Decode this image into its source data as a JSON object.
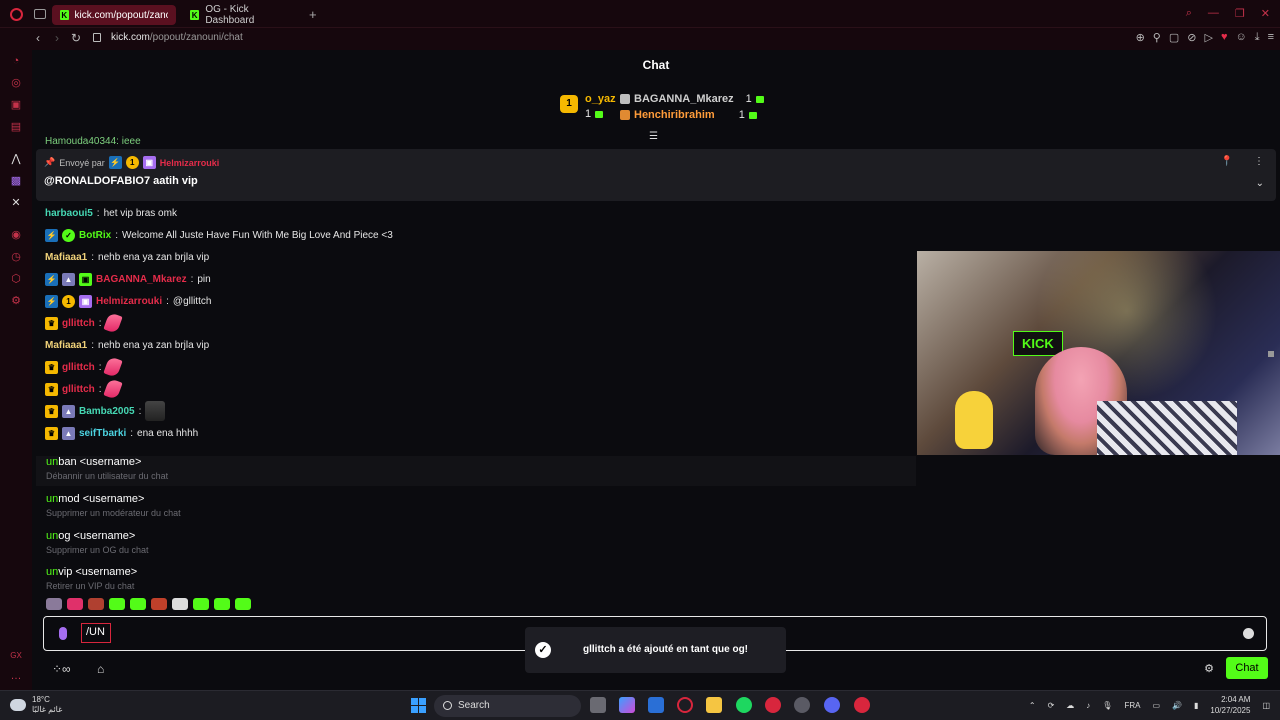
{
  "browser": {
    "tabs": [
      {
        "title": "kick.com/popout/zanouni"
      },
      {
        "title": "OG - Kick Dashboard"
      }
    ],
    "url_host": "kick.com",
    "url_path": "/popout/zanouni/chat"
  },
  "chat": {
    "header_title": "Chat",
    "leaderboard": {
      "first": {
        "rank": "1",
        "name": "o_yaz",
        "count": "1"
      },
      "second": {
        "name": "BAGANNA_Mkarez",
        "count": "1"
      },
      "third": {
        "name": "Henchiribrahim",
        "count": "1"
      }
    },
    "partial_top_line": "Hamouda40344: ieee",
    "pinned": {
      "sent_by_label": "Envoyé par",
      "sender": "Helmizarrouki",
      "message": "@RONALDOFABIO7 aatih vip"
    },
    "messages": [
      {
        "user": "harbaoui5",
        "text": "het vip bras omk"
      },
      {
        "user": "BotRix",
        "text": "Welcome All Juste Have Fun With Me Big Love And Piece <3"
      },
      {
        "user": "Mafiaaa1",
        "text": "nehb ena ya zan brjla vip"
      },
      {
        "user": "BAGANNA_Mkarez",
        "text": "pin"
      },
      {
        "user": "Helmizarrouki",
        "text": "@gllittch"
      },
      {
        "user": "gllittch",
        "text": ""
      },
      {
        "user": "Mafiaaa1",
        "text": "nehb ena ya zan brjla vip"
      },
      {
        "user": "gllittch",
        "text": ""
      },
      {
        "user": "gllittch",
        "text": ""
      },
      {
        "user": "Bamba2005",
        "text": ""
      },
      {
        "user": "seifTbarki",
        "text": "ena ena hhhh"
      }
    ],
    "suggestions": [
      {
        "match": "un",
        "rest": "ban <username>",
        "desc": "Débannir un utilisateur du chat"
      },
      {
        "match": "un",
        "rest": "mod <username>",
        "desc": "Supprimer un modérateur du chat"
      },
      {
        "match": "un",
        "rest": "og <username>",
        "desc": "Supprimer un OG du chat"
      },
      {
        "match": "un",
        "rest": "vip <username>",
        "desc": "Retirer un VIP du chat"
      }
    ],
    "input_value": "/UN",
    "toast": "gllittch a été ajouté en tant que og!",
    "send_button": "Chat",
    "webcam_sign": "KICK"
  },
  "taskbar": {
    "weather_temp": "18°C",
    "weather_desc": "غائم غالبًا",
    "search_placeholder": "Search",
    "language": "FRA",
    "time": "2:04 AM",
    "date": "10/27/2025"
  },
  "colors": {
    "kick_green": "#53fc18",
    "opera_red": "#d8263d",
    "background": "#0b0b0f"
  }
}
